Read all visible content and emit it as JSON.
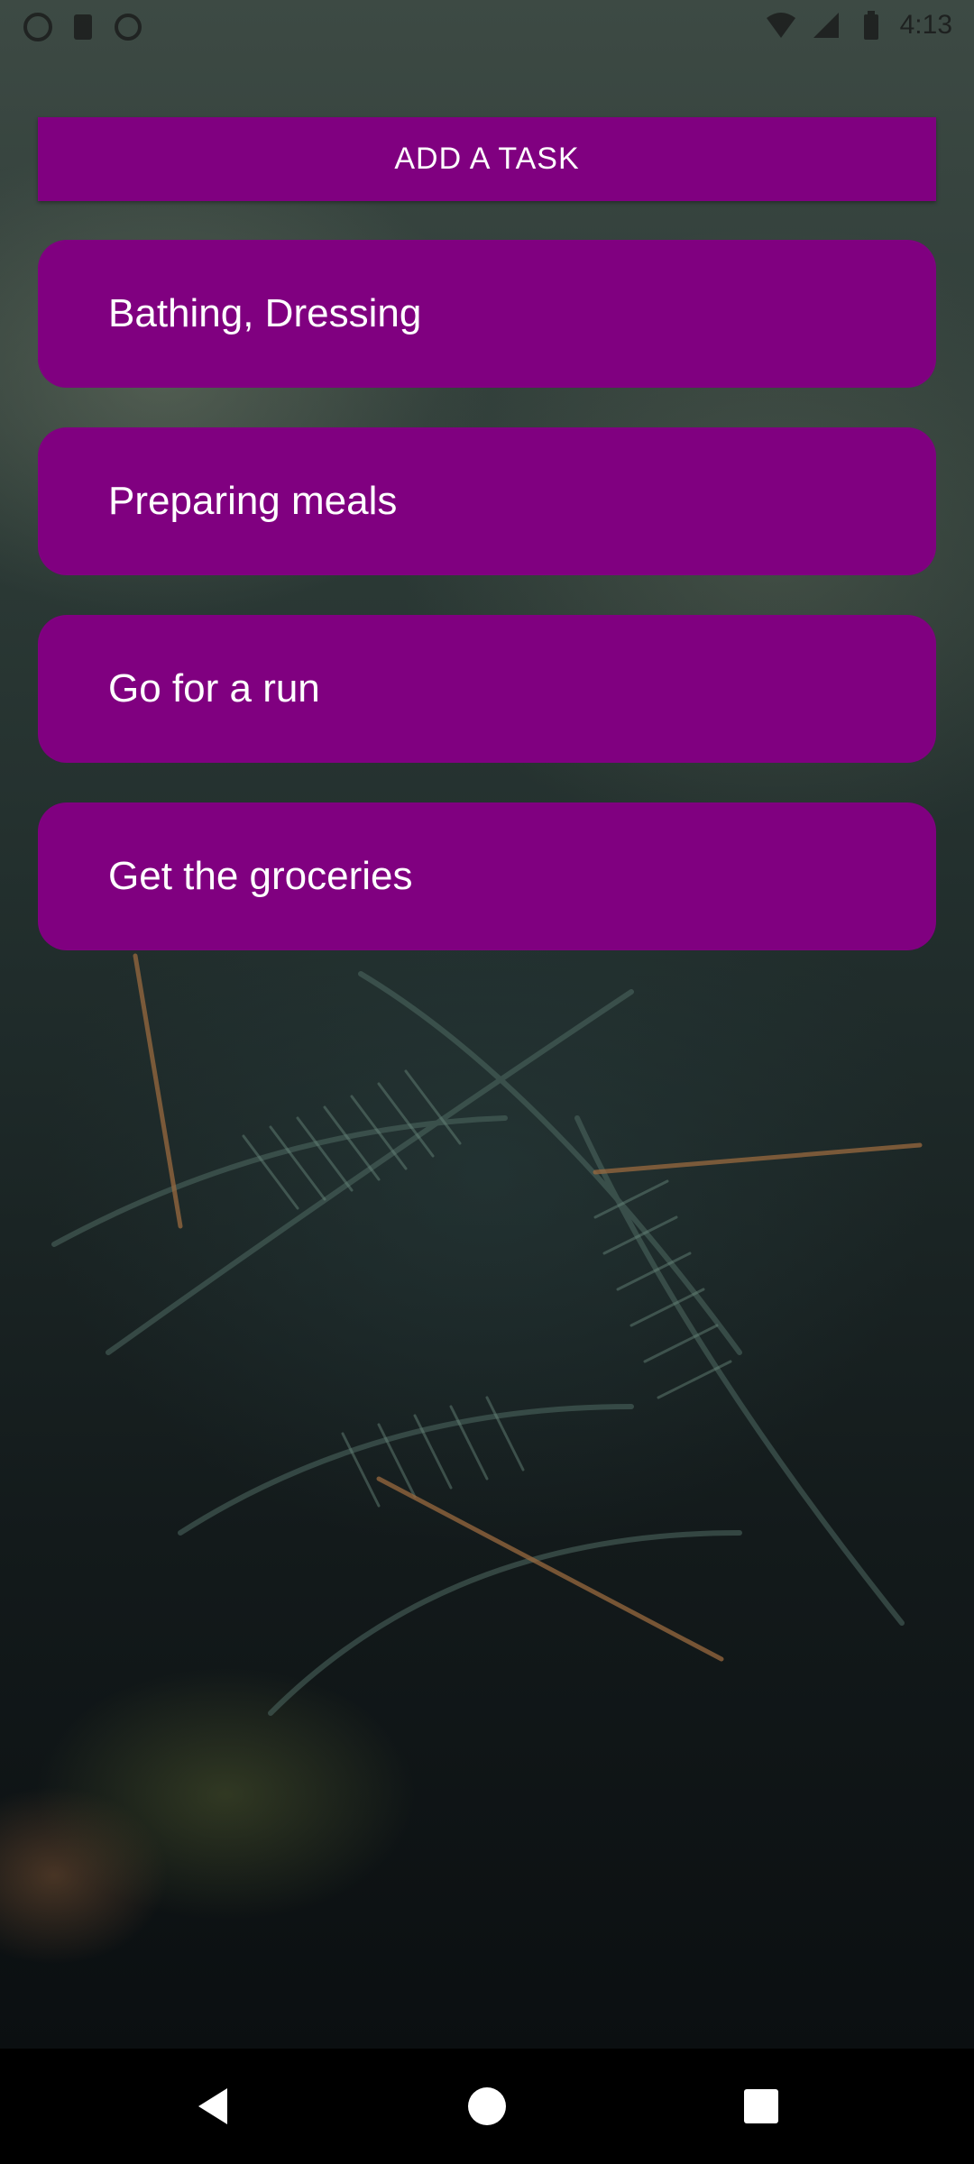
{
  "status_bar": {
    "time": "4:13",
    "left_icons": [
      "app-icon",
      "sim-card-icon",
      "sync-icon"
    ],
    "right_icons": [
      "wifi-icon",
      "signal-icon",
      "battery-icon"
    ]
  },
  "add_task_button": {
    "label": "ADD A TASK"
  },
  "tasks": [
    {
      "label": "Bathing, Dressing"
    },
    {
      "label": "Preparing meals"
    },
    {
      "label": "Go for a run"
    },
    {
      "label": "Get the groceries"
    }
  ],
  "nav_bar": {
    "buttons": [
      "back-icon",
      "home-icon",
      "recents-icon"
    ]
  },
  "colors": {
    "accent": "#800080",
    "text_on_accent": "#ffffff",
    "nav_background": "#000000"
  }
}
